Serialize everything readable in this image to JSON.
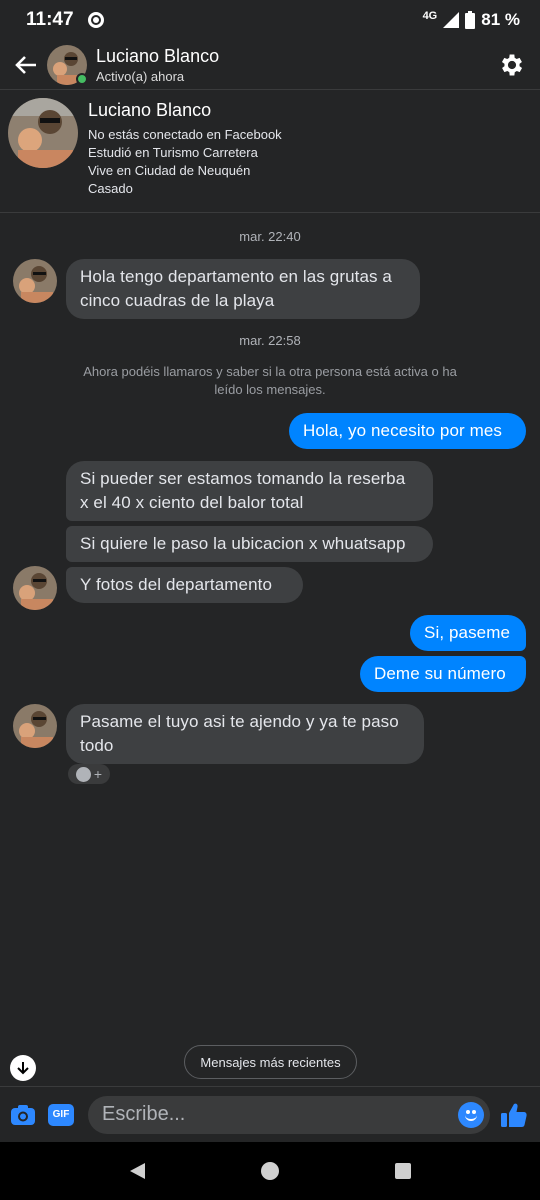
{
  "status_bar": {
    "time": "11:47",
    "network": "4G",
    "battery": "81 %"
  },
  "header": {
    "name": "Luciano Blanco",
    "status": "Activo(a) ahora"
  },
  "profile": {
    "name": "Luciano Blanco",
    "lines": [
      "No estás conectado en Facebook",
      "Estudió en Turismo Carretera",
      "Vive en Ciudad de Neuquén",
      "Casado"
    ]
  },
  "chat": {
    "ts1": "mar. 22:40",
    "msg1": [
      "Hola tengo departamento en las grutas a",
      "cinco cuadras de la playa"
    ],
    "ts2": "mar. 22:58",
    "notice": [
      "Ahora podéis llamaros y saber si la otra persona está activa o ha",
      "leído los mensajes."
    ],
    "out1": "Hola, yo necesito por mes",
    "msg2": [
      "Si pueder ser estamos tomando la reserba",
      "x el 40 x ciento del balor total"
    ],
    "msg3": "Si quiere le paso la ubicacion x whuatsapp",
    "msg4": "Y fotos del  departamento",
    "out2": "Si, paseme",
    "out3": "Deme su número",
    "msg5": [
      "Pasame el tuyo asi te ajendo y ya te paso",
      "todo"
    ],
    "reaction_plus": "+"
  },
  "recent_button": "Mensajes más recientes",
  "composer": {
    "placeholder": "Escribe...",
    "gif_label": "GIF"
  },
  "colors": {
    "accent": "#0084ff",
    "bg": "#242526",
    "incoming": "#3e4042",
    "online": "#45bd62"
  },
  "icons": [
    "back-arrow-icon",
    "gear-icon",
    "camera-icon",
    "gif-icon",
    "emoji-icon",
    "thumbs-up-icon",
    "arrow-down-icon",
    "nav-back-icon",
    "nav-home-icon",
    "nav-recents-icon"
  ]
}
